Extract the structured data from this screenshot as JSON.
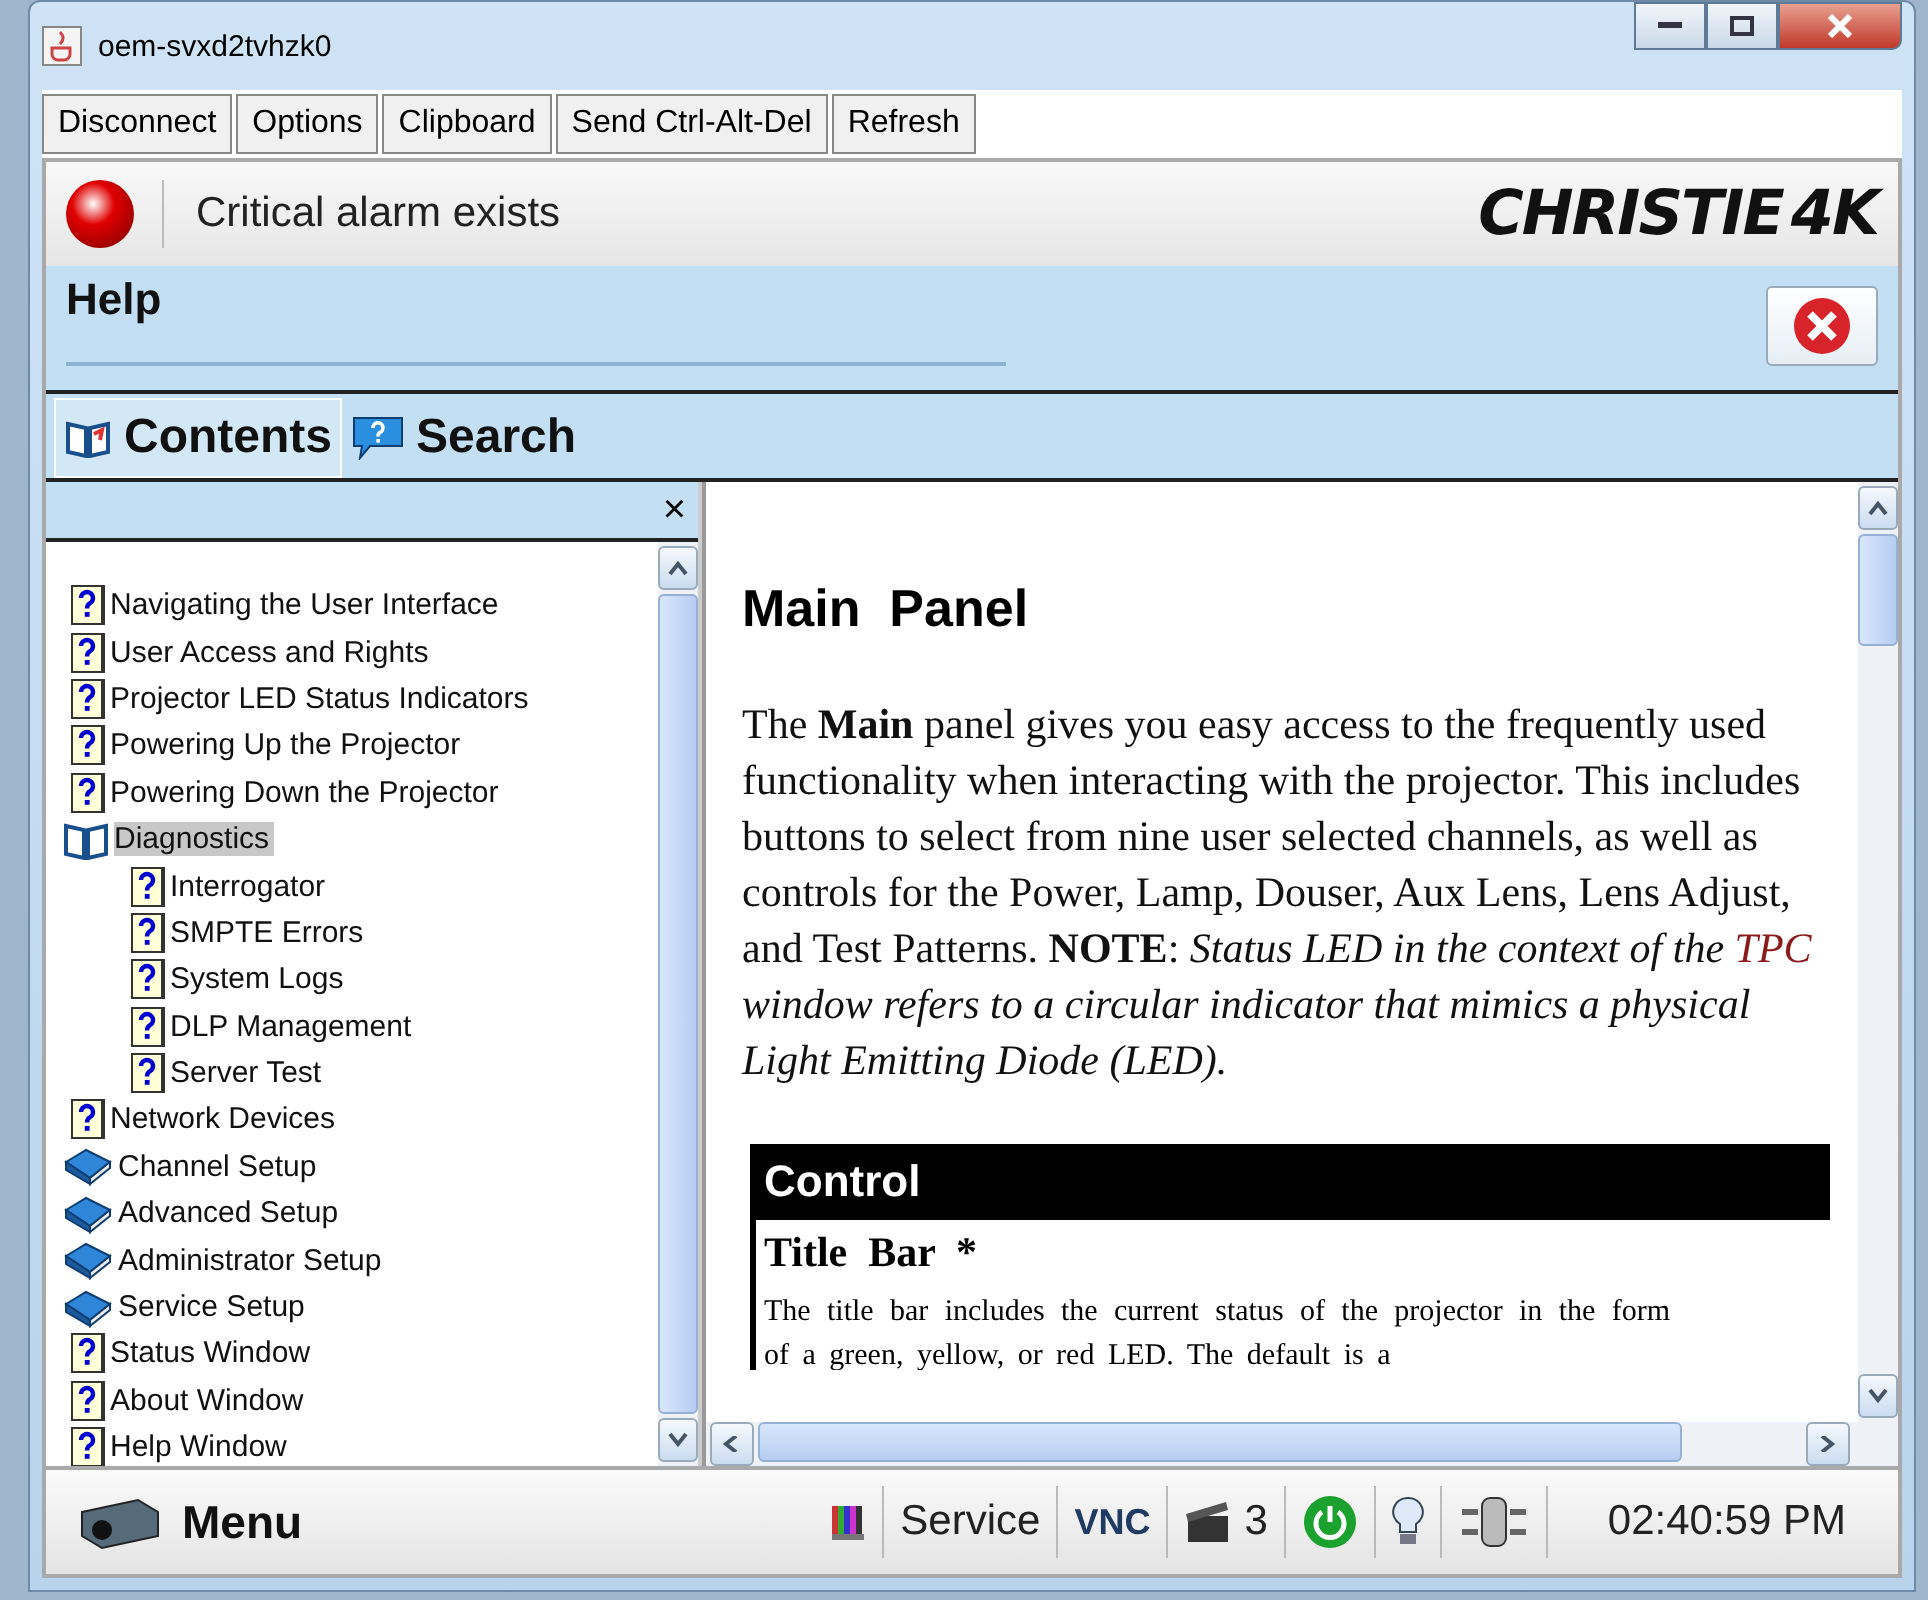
{
  "window": {
    "title": "oem-svxd2tvhzk0"
  },
  "toolbar": [
    "Disconnect",
    "Options",
    "Clipboard",
    "Send Ctrl-Alt-Del",
    "Refresh"
  ],
  "alarm": {
    "text": "Critical alarm exists"
  },
  "logo": {
    "name": "CHRISTIE",
    "suffix": "4K"
  },
  "help": {
    "title": "Help"
  },
  "tabs": [
    {
      "label": "Contents",
      "kind": "contents",
      "selected": true
    },
    {
      "label": "Search",
      "kind": "search",
      "selected": false
    }
  ],
  "tree_close": "×",
  "tree": [
    {
      "label": "Navigating the User Interface",
      "kind": "topic",
      "selected": false
    },
    {
      "label": "User Access and Rights",
      "kind": "topic",
      "selected": false
    },
    {
      "label": "Projector LED Status Indicators",
      "kind": "topic",
      "selected": false
    },
    {
      "label": "Powering Up the Projector",
      "kind": "topic",
      "selected": false
    },
    {
      "label": "Powering Down the Projector",
      "kind": "topic",
      "selected": false
    },
    {
      "label": "Diagnostics",
      "kind": "open-book",
      "selected": true,
      "children": [
        {
          "label": "Interrogator",
          "kind": "topic",
          "selected": false
        },
        {
          "label": "SMPTE Errors",
          "kind": "topic",
          "selected": false
        },
        {
          "label": "System Logs",
          "kind": "topic",
          "selected": false
        },
        {
          "label": "DLP Management",
          "kind": "topic",
          "selected": false
        },
        {
          "label": "Server Test",
          "kind": "topic",
          "selected": false
        }
      ]
    },
    {
      "label": "Network Devices",
      "kind": "topic",
      "selected": false
    },
    {
      "label": "Channel Setup",
      "kind": "book",
      "selected": false
    },
    {
      "label": "Advanced Setup",
      "kind": "book",
      "selected": false
    },
    {
      "label": "Administrator Setup",
      "kind": "book",
      "selected": false
    },
    {
      "label": "Service Setup",
      "kind": "book",
      "selected": false
    },
    {
      "label": "Status Window",
      "kind": "topic",
      "selected": false
    },
    {
      "label": "About Window",
      "kind": "topic",
      "selected": false
    },
    {
      "label": "Help Window",
      "kind": "topic",
      "selected": false
    }
  ],
  "article": {
    "heading": "Main  Panel",
    "paragraph": {
      "before": "The **Main** panel gives you easy access to the frequently used functionality when interacting with the projector. This includes buttons to select from nine user selected channels, as well as controls for the Power, Lamp, Douser, Aux Lens, Lens Adjust, and Test Patterns. **NOTE**: *Status LED in the context of the*",
      "link": "TPC",
      "after": "*window refers to a circular indicator that mimics a physical Light Emitting Diode (LED).*"
    },
    "table": {
      "header": "Control",
      "subheading": "Title  Bar  *",
      "text": "The title bar includes the current status of the projector in the form of a green, yellow, or red LED. The default is a"
    }
  },
  "status_bar": {
    "menu": "Menu",
    "user": "Service",
    "vnc": "VNC",
    "count": "3",
    "time": "02:40:59 PM"
  }
}
